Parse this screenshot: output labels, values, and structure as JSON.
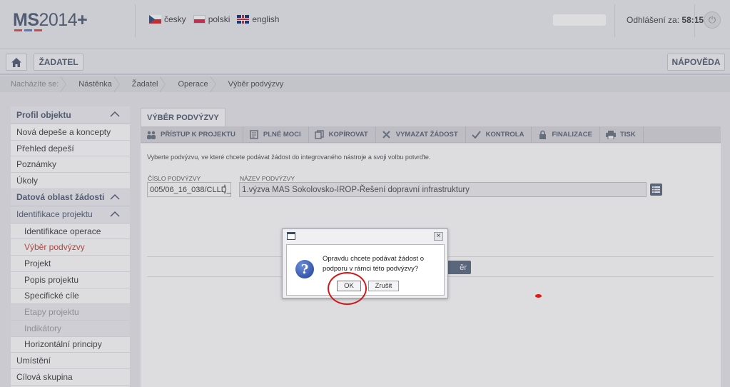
{
  "header": {
    "logo_ms": "MS",
    "logo_year": "2014",
    "logo_plus": "+",
    "logo_bar_colors": [
      "#e63c3c",
      "#4a78c8",
      "#e63c3c"
    ],
    "languages": [
      {
        "label": "česky",
        "flag": "flag-cz"
      },
      {
        "label": "polski",
        "flag": "flag-pl"
      },
      {
        "label": "english",
        "flag": "flag-gb"
      }
    ],
    "logout_label": "Odhlášení za:",
    "logout_time": "58:15",
    "power_icon": "power-icon"
  },
  "navbar": {
    "home_icon": "home-icon",
    "applicant_button": "ŽADATEL",
    "help_button": "NÁPOVĚDA"
  },
  "breadcrumb": {
    "prefix": "Nacházíte se:",
    "items": [
      "Nástěnka",
      "Žadatel",
      "Operace",
      "Výběr podvýzvy"
    ]
  },
  "sidebar": {
    "items": [
      {
        "label": "Profil objektu",
        "type": "group"
      },
      {
        "label": "Nová depeše a koncepty",
        "type": "item"
      },
      {
        "label": "Přehled depeší",
        "type": "item"
      },
      {
        "label": "Poznámky",
        "type": "item"
      },
      {
        "label": "Úkoly",
        "type": "item"
      },
      {
        "label": "Datová oblast žádosti",
        "type": "group"
      },
      {
        "label": "Identifikace projektu",
        "type": "group-plain"
      },
      {
        "label": "Identifikace operace",
        "type": "sub"
      },
      {
        "label": "Výběr podvýzvy",
        "type": "sub-active"
      },
      {
        "label": "Projekt",
        "type": "sub"
      },
      {
        "label": "Popis projektu",
        "type": "sub"
      },
      {
        "label": "Specifické cíle",
        "type": "sub"
      },
      {
        "label": "Etapy projektu",
        "type": "sub-disabled"
      },
      {
        "label": "Indikátory",
        "type": "sub-disabled"
      },
      {
        "label": "Horizontální principy",
        "type": "sub"
      },
      {
        "label": "Umístění",
        "type": "item"
      },
      {
        "label": "Cílová skupina",
        "type": "item"
      }
    ]
  },
  "main": {
    "tab_title": "VÝBĚR PODVÝZVY",
    "toolbar": [
      {
        "label": "PŘÍSTUP K PROJEKTU",
        "icon": "users-icon"
      },
      {
        "label": "PLNÉ MOCI",
        "icon": "document-icon"
      },
      {
        "label": "KOPÍROVAT",
        "icon": "copy-icon"
      },
      {
        "label": "VYMAZAT ŽÁDOST",
        "icon": "delete-icon"
      },
      {
        "label": "KONTROLA",
        "icon": "check-icon"
      },
      {
        "label": "FINALIZACE",
        "icon": "lock-icon"
      },
      {
        "label": "TISK",
        "icon": "print-icon"
      }
    ],
    "instruction": "Vyberte podvýzvu, ve které chcete podávat žádost do integrovaného nástroje a svoji volbu potvrďte.",
    "number_label": "ČÍSLO PODVÝZVY",
    "number_value": "005/06_16_038/CLLD_",
    "name_label": "NÁZEV PODVÝZVY",
    "name_value": "1.výzva MAS Sokolovsko-IROP-Řešení dopravní infrastruktury",
    "confirm_button_partial": "ěr"
  },
  "dialog": {
    "message": "Opravdu chcete podávat žádost o podporu v rámci této podvýzvy?",
    "ok_label": "OK",
    "cancel_label": "Zrušit",
    "close_glyph": "×",
    "question_glyph": "?"
  },
  "annotation_color": "#d01818"
}
